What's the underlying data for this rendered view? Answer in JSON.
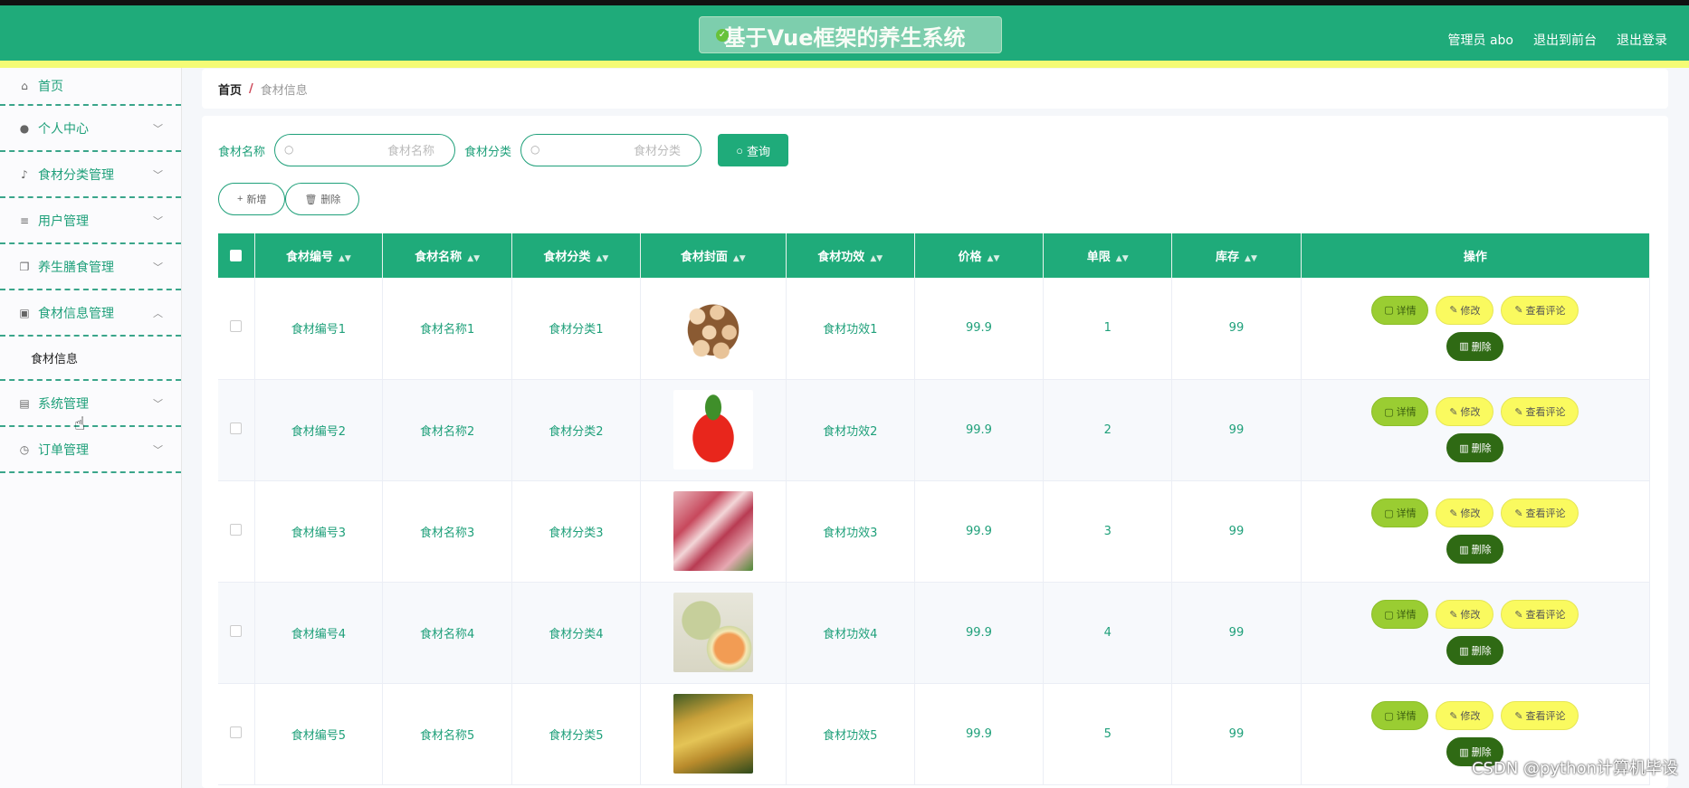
{
  "app": {
    "title": "基于Vue框架的养生系统",
    "toast_text": "",
    "header_links": {
      "admin": "管理员 abo",
      "front": "退出到前台",
      "logout": "退出登录"
    },
    "colors": {
      "primary": "#1fab7a",
      "accent_yellow": "#f4fb75",
      "detail_green": "#9acd32",
      "delete_dark_green": "#2f6a14"
    }
  },
  "sidebar": {
    "items": [
      {
        "label": "首页",
        "icon": "home-icon",
        "expandable": false
      },
      {
        "label": "个人中心",
        "icon": "user-icon",
        "expandable": true
      },
      {
        "label": "食材分类管理",
        "icon": "microphone-icon",
        "expandable": true
      },
      {
        "label": "用户管理",
        "icon": "list-icon",
        "expandable": true
      },
      {
        "label": "养生膳食管理",
        "icon": "copy-icon",
        "expandable": true
      },
      {
        "label": "食材信息管理",
        "icon": "picture-icon",
        "expandable": true,
        "expanded": true
      },
      {
        "label": "系统管理",
        "icon": "suitcase-icon",
        "expandable": true
      },
      {
        "label": "订单管理",
        "icon": "compass-icon",
        "expandable": true
      }
    ],
    "submenu": {
      "label": "食材信息"
    }
  },
  "breadcrumb": {
    "home": "首页",
    "separator": "/",
    "current": "食材信息"
  },
  "search": {
    "name_label": "食材名称",
    "name_placeholder": "食材名称",
    "category_label": "食材分类",
    "category_placeholder": "食材分类",
    "query_button": "查询"
  },
  "actions": {
    "add": "新增",
    "delete": "删除"
  },
  "table": {
    "headers": [
      "食材编号",
      "食材名称",
      "食材分类",
      "食材封面",
      "食材功效",
      "价格",
      "单限",
      "库存",
      "操作"
    ],
    "op_labels": {
      "detail": "详情",
      "edit": "修改",
      "review": "查看评论",
      "delete": "删除"
    },
    "rows": [
      {
        "code": "食材编号1",
        "name": "食材名称1",
        "category": "食材分类1",
        "cover": "eggs",
        "effect": "食材功效1",
        "price": "99.9",
        "limit": "1",
        "stock": "99"
      },
      {
        "code": "食材编号2",
        "name": "食材名称2",
        "category": "食材分类2",
        "cover": "strawberry",
        "effect": "食材功效2",
        "price": "99.9",
        "limit": "2",
        "stock": "99"
      },
      {
        "code": "食材编号3",
        "name": "食材名称3",
        "category": "食材分类3",
        "cover": "meat",
        "effect": "食材功效3",
        "price": "99.9",
        "limit": "3",
        "stock": "99"
      },
      {
        "code": "食材编号4",
        "name": "食材名称4",
        "category": "食材分类4",
        "cover": "melon",
        "effect": "食材功效4",
        "price": "99.9",
        "limit": "4",
        "stock": "99"
      },
      {
        "code": "食材编号5",
        "name": "食材名称5",
        "category": "食材分类5",
        "cover": "starfruit",
        "effect": "食材功效5",
        "price": "99.9",
        "limit": "5",
        "stock": "99"
      }
    ]
  },
  "watermark": "CSDN @python计算机毕设"
}
